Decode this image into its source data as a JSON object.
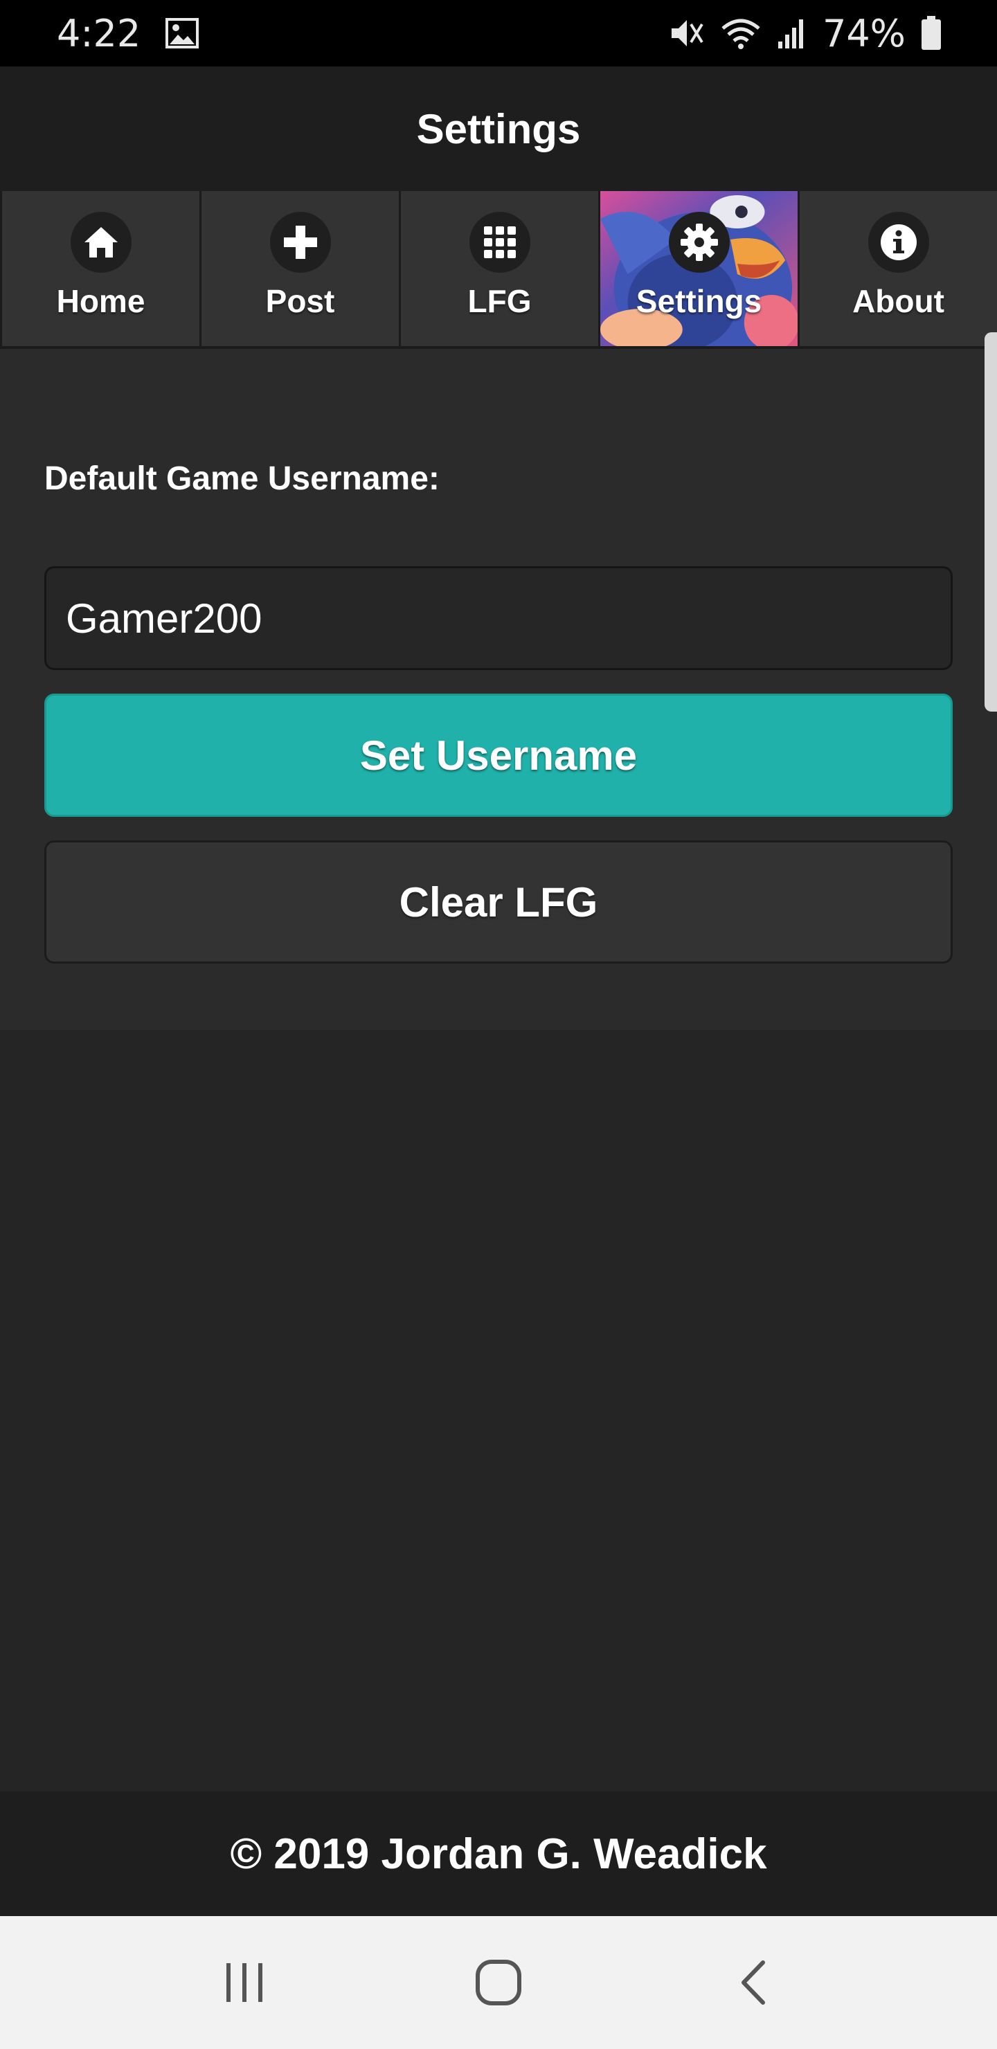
{
  "status_bar": {
    "time": "4:22",
    "battery_percent": "74%",
    "icons": [
      "gallery-icon",
      "mute-icon",
      "wifi-icon",
      "signal-icon",
      "battery-icon"
    ]
  },
  "header": {
    "title": "Settings"
  },
  "tabs": [
    {
      "label": "Home",
      "icon": "home-icon",
      "active": false
    },
    {
      "label": "Post",
      "icon": "plus-icon",
      "active": false
    },
    {
      "label": "LFG",
      "icon": "grid-icon",
      "active": false
    },
    {
      "label": "Settings",
      "icon": "gear-icon",
      "active": true
    },
    {
      "label": "About",
      "icon": "info-icon",
      "active": false
    }
  ],
  "settings": {
    "username_label": "Default Game Username:",
    "username_value": "Gamer200",
    "set_button": "Set Username",
    "clear_button": "Clear LFG"
  },
  "footer": {
    "text": "© 2019 Jordan G. Weadick"
  },
  "nav": {
    "icons": [
      "recents-icon",
      "home-circle-icon",
      "back-icon"
    ]
  },
  "colors": {
    "accent": "#20b2aa",
    "background": "#252525",
    "panel": "#2b2b2b",
    "tab": "#333333"
  }
}
